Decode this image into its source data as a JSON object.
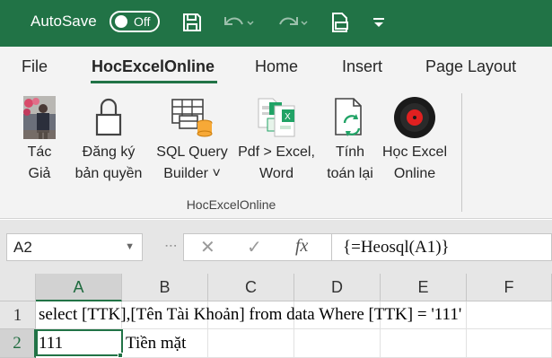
{
  "titlebar": {
    "autosave_label": "AutoSave",
    "autosave_state": "Off",
    "icons": [
      "save-icon",
      "undo-icon",
      "redo-icon",
      "print-preview-icon",
      "customize-toolbar-icon"
    ]
  },
  "tabs": [
    {
      "label": "File",
      "active": false
    },
    {
      "label": "HocExcelOnline",
      "active": true
    },
    {
      "label": "Home",
      "active": false
    },
    {
      "label": "Insert",
      "active": false
    },
    {
      "label": "Page Layout",
      "active": false
    }
  ],
  "ribbon": {
    "group_label": "HocExcelOnline",
    "buttons": [
      {
        "line1": "Tác",
        "line2": "Giả",
        "icon": "author-photo-icon"
      },
      {
        "line1": "Đăng ký",
        "line2": "bản quyền",
        "icon": "lock-icon"
      },
      {
        "line1": "SQL Query",
        "line2": "Builder ˅",
        "icon": "sql-query-icon"
      },
      {
        "line1": "Pdf > Excel,",
        "line2": "Word",
        "icon": "pdf-convert-icon"
      },
      {
        "line1": "Tính",
        "line2": "toán lại",
        "icon": "recalculate-icon"
      },
      {
        "line1": "Học Excel",
        "line2": "Online",
        "icon": "record-icon"
      }
    ]
  },
  "formula_bar": {
    "name_box": "A2",
    "fx_label": "fx",
    "formula": "{=Heosql(A1)}"
  },
  "grid": {
    "columns": [
      "A",
      "B",
      "C",
      "D",
      "E",
      "F"
    ],
    "rows": [
      {
        "num": "1",
        "cells": [
          "select [TTK],[Tên Tài Khoản] from data Where [TTK] = '111'"
        ]
      },
      {
        "num": "2",
        "cells": [
          "111",
          "Tiền mặt"
        ]
      }
    ],
    "active_cell": "A2"
  },
  "colors": {
    "accent": "#217346",
    "ribbon_bg": "#f3f3f3",
    "header_bg": "#e6e6e6"
  }
}
